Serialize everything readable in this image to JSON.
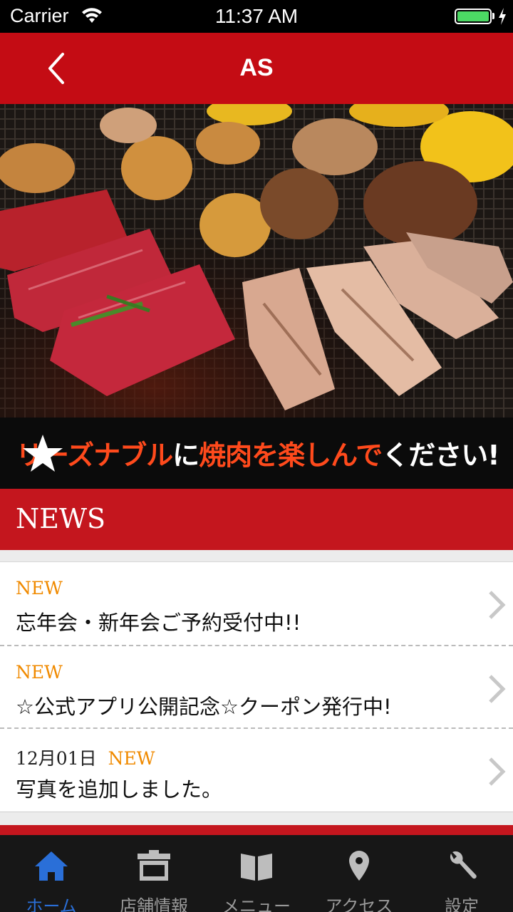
{
  "status_bar": {
    "carrier": "Carrier",
    "time": "11:37 AM",
    "battery_level": 1.0,
    "battery_color": "#4cd964"
  },
  "nav": {
    "title": "AS",
    "back_icon": "chevron-left-icon",
    "background_color": "#c40c14"
  },
  "hero": {
    "image": "grilled-yakiniku-meat-photo",
    "banner_segments": [
      {
        "text": "リーズナブル",
        "color": "#ff4a1c"
      },
      {
        "text": "に",
        "color": "#ffffff"
      },
      {
        "text": "焼肉を楽しんで",
        "color": "#ff4a1c"
      },
      {
        "text": "ください!",
        "color": "#ffffff"
      }
    ],
    "banner_icon": "star-icon"
  },
  "news": {
    "header": "NEWS",
    "items": [
      {
        "date": "",
        "badge": "NEW",
        "title": "忘年会・新年会ご予約受付中!!"
      },
      {
        "date": "",
        "badge": "NEW",
        "title": "☆公式アプリ公開記念☆クーポン発行中!"
      },
      {
        "date": "12月01日",
        "badge": "NEW",
        "title": "写真を追加しました。"
      }
    ]
  },
  "tabs": [
    {
      "label": "ホーム",
      "icon": "home-icon",
      "active": true
    },
    {
      "label": "店舗情報",
      "icon": "store-icon",
      "active": false
    },
    {
      "label": "メニュー",
      "icon": "book-icon",
      "active": false
    },
    {
      "label": "アクセス",
      "icon": "location-pin-icon",
      "active": false
    },
    {
      "label": "設定",
      "icon": "wrench-icon",
      "active": false
    }
  ],
  "colors": {
    "accent_red": "#c4161e",
    "new_badge": "#f08a00",
    "active_tab": "#2a6fd8",
    "inactive_tab": "#9a9a9a"
  }
}
